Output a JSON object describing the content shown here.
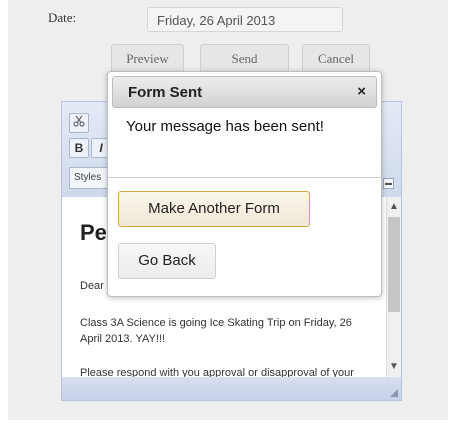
{
  "form": {
    "date_label": "Date:",
    "date_value": "Friday, 26 April 2013",
    "buttons": {
      "preview": "Preview",
      "send": "Send",
      "cancel": "Cancel"
    }
  },
  "editor": {
    "toolbar": {
      "bold": "B",
      "italic": "I",
      "styles_label": "Styles",
      "cut_icon": "scissors-icon",
      "collapse_icon": "collapse-icon"
    },
    "body": {
      "heading": "Pe",
      "greeting": "Dear",
      "paragraph": "Class 3A Science is going Ice Skating Trip on Friday, 26 April 2013. YAY!!!",
      "paragraph2": "Please respond with you approval or disapproval of your"
    }
  },
  "modal": {
    "title": "Form Sent",
    "close": "×",
    "message": "Your message has been sent!",
    "make_another": "Make Another Form",
    "go_back": "Go Back"
  },
  "colors": {
    "editor_frame": "#b7c4dc",
    "focus_border": "#d2a64c"
  }
}
